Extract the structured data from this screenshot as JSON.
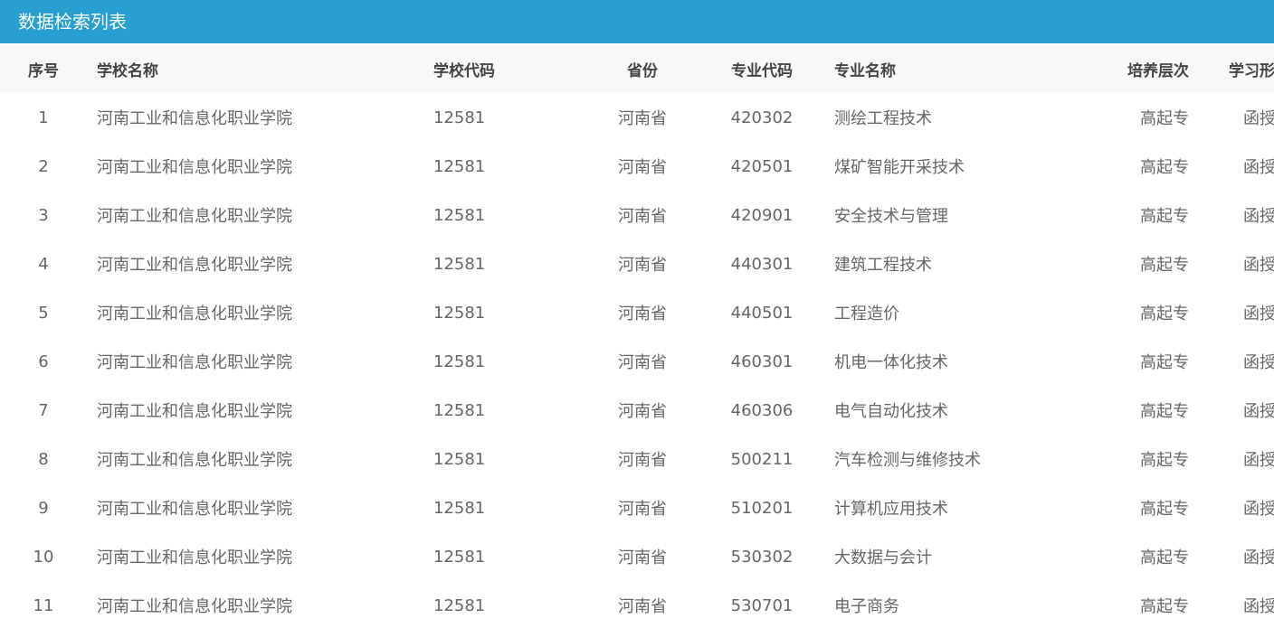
{
  "panel": {
    "title": "数据检索列表"
  },
  "table": {
    "columns": {
      "index": "序号",
      "school_name": "学校名称",
      "school_code": "学校代码",
      "province": "省份",
      "major_code": "专业代码",
      "major_name": "专业名称",
      "level": "培养层次",
      "study_form": "学习形式"
    },
    "rows": [
      {
        "index": "1",
        "school_name": "河南工业和信息化职业学院",
        "school_code": "12581",
        "province": "河南省",
        "major_code": "420302",
        "major_name": "测绘工程技术",
        "level": "高起专",
        "study_form": "函授"
      },
      {
        "index": "2",
        "school_name": "河南工业和信息化职业学院",
        "school_code": "12581",
        "province": "河南省",
        "major_code": "420501",
        "major_name": "煤矿智能开采技术",
        "level": "高起专",
        "study_form": "函授"
      },
      {
        "index": "3",
        "school_name": "河南工业和信息化职业学院",
        "school_code": "12581",
        "province": "河南省",
        "major_code": "420901",
        "major_name": "安全技术与管理",
        "level": "高起专",
        "study_form": "函授"
      },
      {
        "index": "4",
        "school_name": "河南工业和信息化职业学院",
        "school_code": "12581",
        "province": "河南省",
        "major_code": "440301",
        "major_name": "建筑工程技术",
        "level": "高起专",
        "study_form": "函授"
      },
      {
        "index": "5",
        "school_name": "河南工业和信息化职业学院",
        "school_code": "12581",
        "province": "河南省",
        "major_code": "440501",
        "major_name": "工程造价",
        "level": "高起专",
        "study_form": "函授"
      },
      {
        "index": "6",
        "school_name": "河南工业和信息化职业学院",
        "school_code": "12581",
        "province": "河南省",
        "major_code": "460301",
        "major_name": "机电一体化技术",
        "level": "高起专",
        "study_form": "函授"
      },
      {
        "index": "7",
        "school_name": "河南工业和信息化职业学院",
        "school_code": "12581",
        "province": "河南省",
        "major_code": "460306",
        "major_name": "电气自动化技术",
        "level": "高起专",
        "study_form": "函授"
      },
      {
        "index": "8",
        "school_name": "河南工业和信息化职业学院",
        "school_code": "12581",
        "province": "河南省",
        "major_code": "500211",
        "major_name": "汽车检测与维修技术",
        "level": "高起专",
        "study_form": "函授"
      },
      {
        "index": "9",
        "school_name": "河南工业和信息化职业学院",
        "school_code": "12581",
        "province": "河南省",
        "major_code": "510201",
        "major_name": "计算机应用技术",
        "level": "高起专",
        "study_form": "函授"
      },
      {
        "index": "10",
        "school_name": "河南工业和信息化职业学院",
        "school_code": "12581",
        "province": "河南省",
        "major_code": "530302",
        "major_name": "大数据与会计",
        "level": "高起专",
        "study_form": "函授"
      },
      {
        "index": "11",
        "school_name": "河南工业和信息化职业学院",
        "school_code": "12581",
        "province": "河南省",
        "major_code": "530701",
        "major_name": "电子商务",
        "level": "高起专",
        "study_form": "函授"
      }
    ]
  }
}
